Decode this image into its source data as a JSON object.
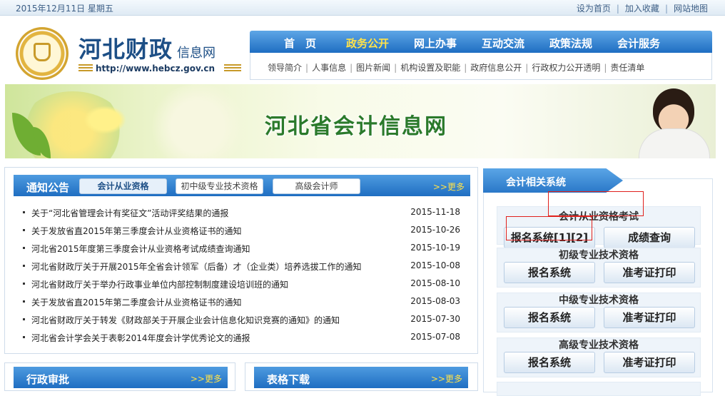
{
  "topbar": {
    "date": "2015年12月11日 星期五",
    "links": [
      "设为首页",
      "加入收藏",
      "网站地图"
    ]
  },
  "logo": {
    "title": "河北财政",
    "subtitle": "信息网",
    "url": "http://www.hebcz.gov.cn"
  },
  "nav": {
    "items": [
      "首　页",
      "政务公开",
      "网上办事",
      "互动交流",
      "政策法规",
      "会计服务"
    ],
    "active_index": 1,
    "subitems": [
      "领导简介",
      "人事信息",
      "图片新闻",
      "机构设置及职能",
      "政府信息公开",
      "行政权力公开透明",
      "责任清单"
    ]
  },
  "banner": {
    "title": "河北省会计信息网"
  },
  "notice": {
    "label": "通知公告",
    "tabs": [
      "会计从业资格",
      "初中级专业技术资格",
      "高级会计师"
    ],
    "more": "更多",
    "items": [
      {
        "title": "关于“河北省管理会计有奖征文”活动评奖结果的通报",
        "date": "2015-11-18"
      },
      {
        "title": "关于发放省直2015年第三季度会计从业资格证书的通知",
        "date": "2015-10-26"
      },
      {
        "title": "河北省2015年度第三季度会计从业资格考试成绩查询通知",
        "date": "2015-10-19"
      },
      {
        "title": "河北省财政厅关于开展2015年全省会计领军（后备）才（企业类）培养选拔工作的通知",
        "date": "2015-10-08"
      },
      {
        "title": "河北省财政厅关于举办行政事业单位内部控制制度建设培训班的通知",
        "date": "2015-08-10"
      },
      {
        "title": "关于发放省直2015年第二季度会计从业资格证书的通知",
        "date": "2015-08-03"
      },
      {
        "title": "河北省财政厅关于转发《财政部关于开展企业会计信息化知识竞赛的通知》的通知",
        "date": "2015-07-30"
      },
      {
        "title": "河北省会计学会关于表彰2014年度会计学优秀论文的通报",
        "date": "2015-07-08"
      }
    ]
  },
  "bottom": {
    "admin_label": "行政审批",
    "forms_label": "表格下载",
    "more": "更多"
  },
  "systems": {
    "title": "会计相关系统",
    "sections": [
      {
        "head": "会计从业资格考试",
        "btn1": "报名系统[1][2]",
        "btn2": "成绩查询"
      },
      {
        "head": "初级专业技术资格",
        "btn1": "报名系统",
        "btn2": "准考证打印"
      },
      {
        "head": "中级专业技术资格",
        "btn1": "报名系统",
        "btn2": "准考证打印"
      },
      {
        "head": "高级专业技术资格",
        "btn1": "报名系统",
        "btn2": "准考证打印"
      }
    ],
    "highlight_color": "#e0201c"
  },
  "colors": {
    "nav_blue": "#1f6ec2",
    "active_yellow": "#ffe24a",
    "banner_green": "#2b7a2b"
  }
}
